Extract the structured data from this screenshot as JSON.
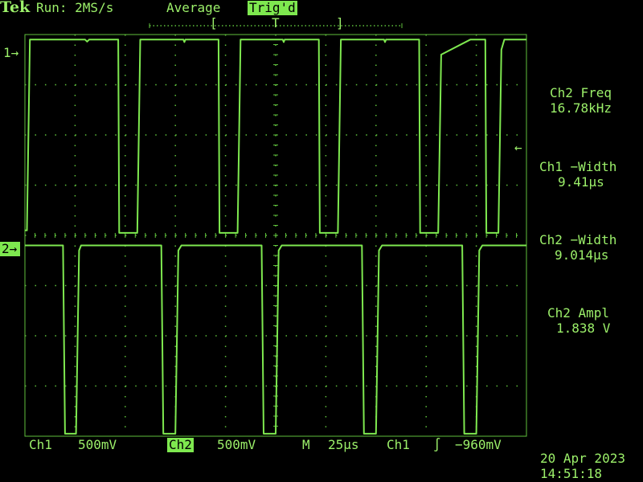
{
  "header": {
    "brand": "Tek",
    "run_status": "Run: 2MS/s",
    "acq_mode": "Average",
    "trig_status": "Trig'd",
    "trig_pos_left": "[",
    "trig_pos_marker": "T",
    "trig_pos_right": "]"
  },
  "markers": {
    "ch1": "1→",
    "ch2": "2→",
    "trigger_level": "←"
  },
  "measurements": [
    {
      "label": "Ch2 Freq",
      "value": "16.78kHz"
    },
    {
      "label": "Ch1 −Width",
      "value": "9.41µs"
    },
    {
      "label": "Ch2 −Width",
      "value": "9.014µs"
    },
    {
      "label": "Ch2 Ampl",
      "value": "1.838 V"
    }
  ],
  "footer": {
    "ch1_label": "Ch1",
    "ch1_scale": "500mV",
    "ch2_label": "Ch2",
    "ch2_scale": "500mV",
    "timebase_label": "M",
    "timebase": "25µs",
    "trig_source": "Ch1",
    "trig_slope": "∫",
    "trig_level": "−960mV",
    "date": "20 Apr 2023",
    "time": "14:51:18"
  },
  "colors": {
    "trace": "#7ee84f",
    "grid": "#5fbf3c",
    "background": "#000000"
  },
  "chart_data": {
    "type": "line",
    "title": "",
    "xlabel": "",
    "ylabel": "",
    "grid": true,
    "x_divisions": 10,
    "y_divisions": 8,
    "xlim": [
      -125,
      125
    ],
    "x_unit": "µs",
    "series": [
      {
        "name": "Ch1",
        "volts_per_div": 0.5,
        "ylim_div": [
          0,
          4
        ],
        "points": [
          [
            -125,
            0.1
          ],
          [
            -124,
            0.1
          ],
          [
            -122.5,
            3.9
          ],
          [
            -95,
            3.9
          ],
          [
            -94,
            3.86
          ],
          [
            -93,
            3.9
          ],
          [
            -78.5,
            3.9
          ],
          [
            -78,
            0.05
          ],
          [
            -69,
            0.05
          ],
          [
            -67.5,
            3.9
          ],
          [
            -46,
            3.9
          ],
          [
            -45.5,
            3.85
          ],
          [
            -45,
            3.9
          ],
          [
            -28.5,
            3.9
          ],
          [
            -28,
            0.05
          ],
          [
            -19,
            0.05
          ],
          [
            -17.5,
            3.9
          ],
          [
            3.5,
            3.9
          ],
          [
            4,
            3.85
          ],
          [
            4.5,
            3.9
          ],
          [
            21.5,
            3.9
          ],
          [
            22,
            0.05
          ],
          [
            31,
            0.05
          ],
          [
            32.5,
            3.9
          ],
          [
            54,
            3.9
          ],
          [
            54.5,
            3.85
          ],
          [
            55,
            3.9
          ],
          [
            71.5,
            3.9
          ],
          [
            72,
            0.05
          ],
          [
            81,
            0.05
          ],
          [
            82.5,
            3.6
          ],
          [
            97,
            3.9
          ],
          [
            104.5,
            3.9
          ],
          [
            105,
            0.05
          ],
          [
            111,
            0.05
          ],
          [
            112.5,
            3.7
          ],
          [
            114,
            3.9
          ],
          [
            125,
            3.9
          ]
        ]
      },
      {
        "name": "Ch2",
        "volts_per_div": 0.5,
        "ylim_div": [
          -4,
          0
        ],
        "points": [
          [
            -125,
            -0.2
          ],
          [
            -106,
            -0.2
          ],
          [
            -105,
            -3.95
          ],
          [
            -99.5,
            -3.95
          ],
          [
            -98,
            -0.3
          ],
          [
            -97,
            -0.2
          ],
          [
            -57,
            -0.2
          ],
          [
            -56,
            -3.95
          ],
          [
            -50,
            -3.95
          ],
          [
            -48.5,
            -0.3
          ],
          [
            -47,
            -0.2
          ],
          [
            -7,
            -0.2
          ],
          [
            -6,
            -3.95
          ],
          [
            0,
            -3.95
          ],
          [
            1.5,
            -0.3
          ],
          [
            3,
            -0.2
          ],
          [
            43,
            -0.2
          ],
          [
            44,
            -3.95
          ],
          [
            50,
            -3.95
          ],
          [
            51.5,
            -0.3
          ],
          [
            53,
            -0.2
          ],
          [
            93,
            -0.2
          ],
          [
            94,
            -3.95
          ],
          [
            100,
            -3.95
          ],
          [
            101.5,
            -0.3
          ],
          [
            103,
            -0.2
          ],
          [
            125,
            -0.2
          ]
        ]
      }
    ]
  }
}
